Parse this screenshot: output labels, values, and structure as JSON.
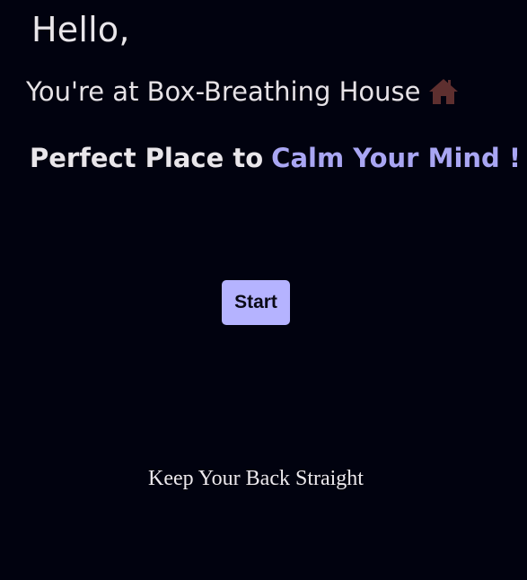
{
  "header": {
    "greeting": "Hello,",
    "subtitle": "You're at Box-Breathing House",
    "subtitle_icon": "house-icon",
    "tagline_prefix": "Perfect Place to",
    "tagline_accent": "Calm Your Mind !"
  },
  "controls": {
    "start_label": "Start"
  },
  "footer": {
    "instruction": "Keep Your Back Straight"
  },
  "colors": {
    "background": "#01020f",
    "accent": "#a9a6f3",
    "button": "#b5b3ff",
    "house_icon": "#5e2f2f"
  }
}
